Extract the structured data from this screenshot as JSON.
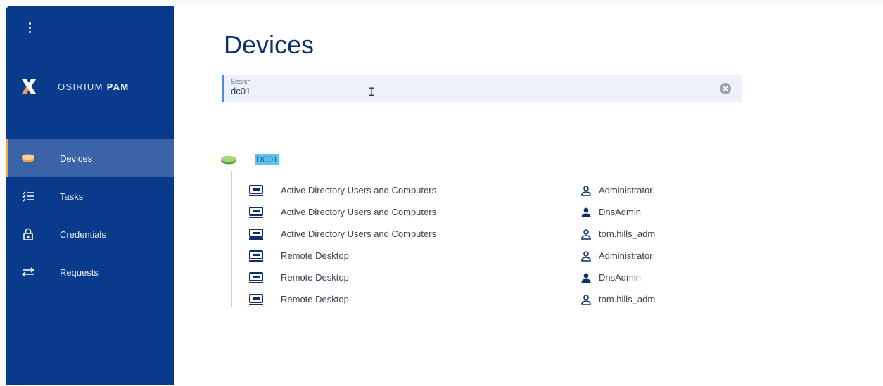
{
  "sidebar": {
    "brand": {
      "name_light": "OSIRIUM",
      "name_bold": "PAM"
    },
    "nav": [
      {
        "label": "Devices",
        "icon": "devices-icon",
        "active": true
      },
      {
        "label": "Tasks",
        "icon": "tasks-icon",
        "active": false
      },
      {
        "label": "Credentials",
        "icon": "lock-icon",
        "active": false
      },
      {
        "label": "Requests",
        "icon": "swap-arrows-icon",
        "active": false
      }
    ]
  },
  "main": {
    "title": "Devices",
    "search": {
      "label": "Search",
      "value": "dc01"
    },
    "device": {
      "name": "DC01",
      "connections": [
        {
          "app": "Active Directory Users and Computers",
          "user": "Administrator",
          "user_icon": "outline"
        },
        {
          "app": "Active Directory Users and Computers",
          "user": "DnsAdmin",
          "user_icon": "filled"
        },
        {
          "app": "Active Directory Users and Computers",
          "user": "tom.hills_adm",
          "user_icon": "outline"
        },
        {
          "app": "Remote Desktop",
          "user": "Administrator",
          "user_icon": "outline"
        },
        {
          "app": "Remote Desktop",
          "user": "DnsAdmin",
          "user_icon": "filled"
        },
        {
          "app": "Remote Desktop",
          "user": "tom.hills_adm",
          "user_icon": "outline"
        }
      ]
    }
  },
  "colors": {
    "sidebar_bg": "#0a3a8c",
    "active_item_bg": "#3a63a8",
    "accent_orange": "#f2a33a",
    "title_color": "#0d2f6b",
    "highlight": "#62c1e8"
  }
}
